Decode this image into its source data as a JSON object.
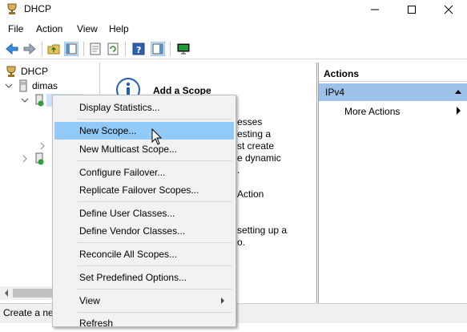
{
  "window": {
    "title": "DHCP"
  },
  "menu": [
    "File",
    "Action",
    "View",
    "Help"
  ],
  "tree": {
    "root": "DHCP",
    "server": "dimas"
  },
  "center": {
    "heading": "Add a Scope",
    "fragments": [
      "esses",
      "esting a",
      "st create",
      "e dynamic",
      ".",
      "Action",
      "setting up a",
      "o."
    ]
  },
  "actions": {
    "header": "Actions",
    "ipv4": "IPv4",
    "more": "More Actions"
  },
  "context_menu": [
    "Display Statistics...",
    "New Scope...",
    "New Multicast Scope...",
    "Configure Failover...",
    "Replicate Failover Scopes...",
    "Define User Classes...",
    "Define Vendor Classes...",
    "Reconcile All Scopes...",
    "Set Predefined Options...",
    "View",
    "Refresh"
  ],
  "status": {
    "text": "Create a new"
  },
  "colors": {
    "highlight": "#91c9f7",
    "ipv4_band": "#9dc1e8"
  }
}
